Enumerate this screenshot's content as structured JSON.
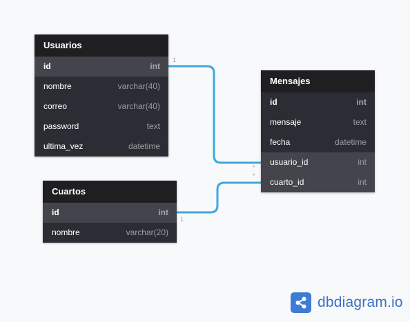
{
  "tables": {
    "usuarios": {
      "name": "Usuarios",
      "columns": [
        {
          "name": "id",
          "type": "int"
        },
        {
          "name": "nombre",
          "type": "varchar(40)"
        },
        {
          "name": "correo",
          "type": "varchar(40)"
        },
        {
          "name": "password",
          "type": "text"
        },
        {
          "name": "ultima_vez",
          "type": "datetime"
        }
      ]
    },
    "cuartos": {
      "name": "Cuartos",
      "columns": [
        {
          "name": "id",
          "type": "int"
        },
        {
          "name": "nombre",
          "type": "varchar(20)"
        }
      ]
    },
    "mensajes": {
      "name": "Mensajes",
      "columns": [
        {
          "name": "id",
          "type": "int"
        },
        {
          "name": "mensaje",
          "type": "text"
        },
        {
          "name": "fecha",
          "type": "datetime"
        },
        {
          "name": "usuario_id",
          "type": "int"
        },
        {
          "name": "cuarto_id",
          "type": "int"
        }
      ]
    }
  },
  "relations": [
    {
      "from": "Usuarios.id",
      "to": "Mensajes.usuario_id",
      "card_one": "1",
      "card_many": "*"
    },
    {
      "from": "Cuartos.id",
      "to": "Mensajes.cuarto_id",
      "card_one": "1",
      "card_many": "*"
    }
  ],
  "colors": {
    "link": "#3ea8de",
    "brand": "#3e7bd6",
    "header": "#1f1f21",
    "body": "#2b2d34"
  },
  "brand": {
    "text": "dbdiagram.io",
    "icon": "share-icon"
  }
}
